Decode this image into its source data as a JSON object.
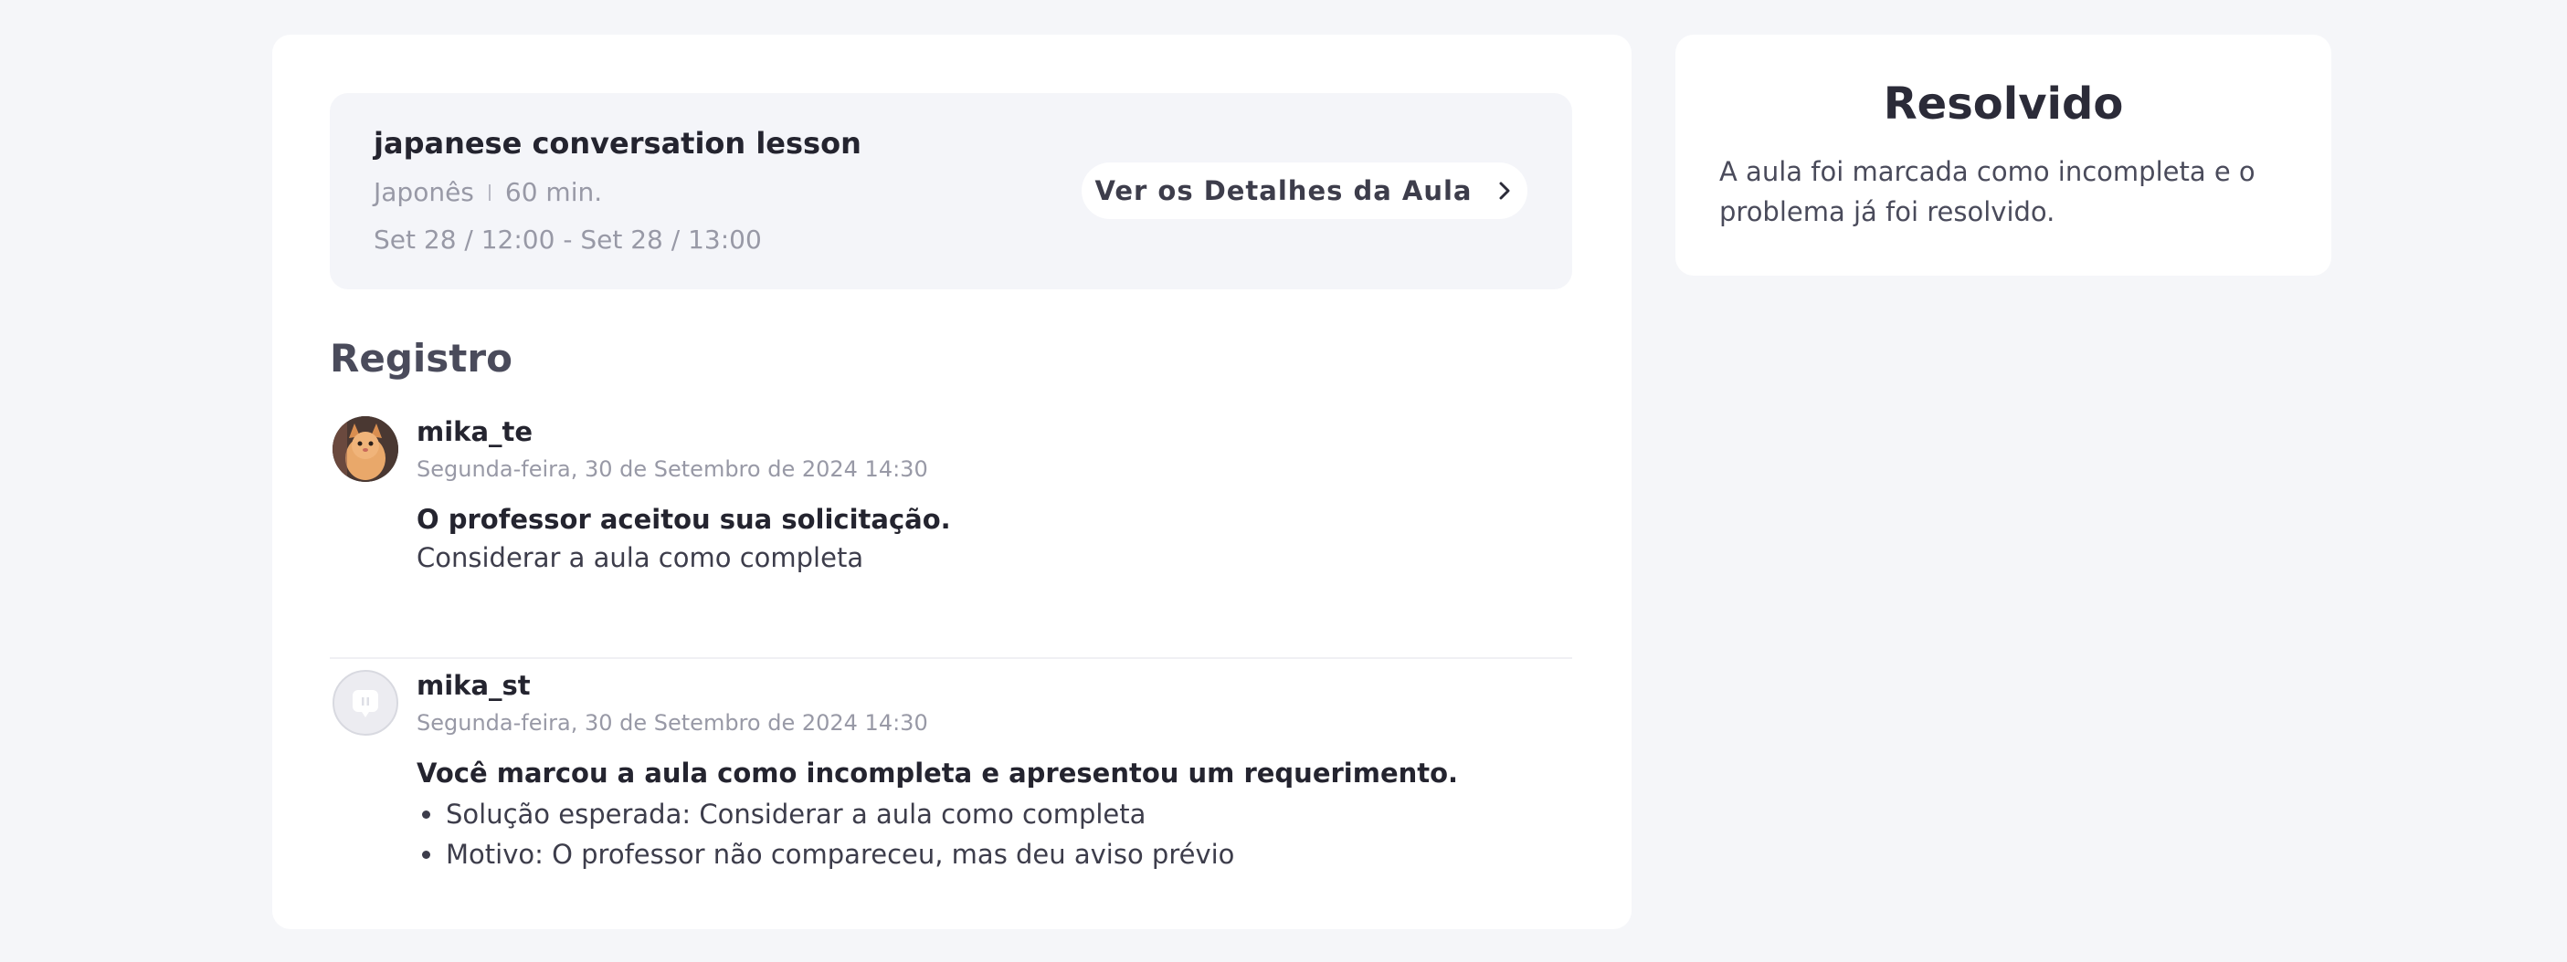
{
  "lesson": {
    "title": "japanese conversation lesson",
    "language": "Japonês",
    "duration": "60 min.",
    "time_range": "Set 28 / 12:00 - Set 28 / 13:00",
    "details_button": "Ver os Detalhes da Aula",
    "details_icon": "chevron-right-icon"
  },
  "log": {
    "title": "Registro",
    "entries": [
      {
        "username": "mika_te",
        "date": "Segunda-feira, 30 de Setembro de 2024 14:30",
        "message": "O professor aceitou sua solicitação.",
        "detail": "Considerar a aula como completa",
        "avatar": "cat-photo"
      },
      {
        "username": "mika_st",
        "date": "Segunda-feira, 30 de Setembro de 2024 14:30",
        "message": "Você marcou a aula como incompleta e apresentou um requerimento.",
        "bullets": [
          "Solução esperada: Considerar a aula como completa",
          "Motivo: O professor não compareceu, mas deu aviso prévio"
        ],
        "avatar": "default-avatar-icon"
      }
    ]
  },
  "status": {
    "title": "Resolvido",
    "description": "A aula foi marcada como incompleta e o problema já foi resolvido."
  },
  "colors": {
    "background": "#f5f6f9",
    "card": "#ffffff",
    "panel": "#f4f5f9",
    "text_dark": "#24242f",
    "text_muted": "#9899a6"
  }
}
